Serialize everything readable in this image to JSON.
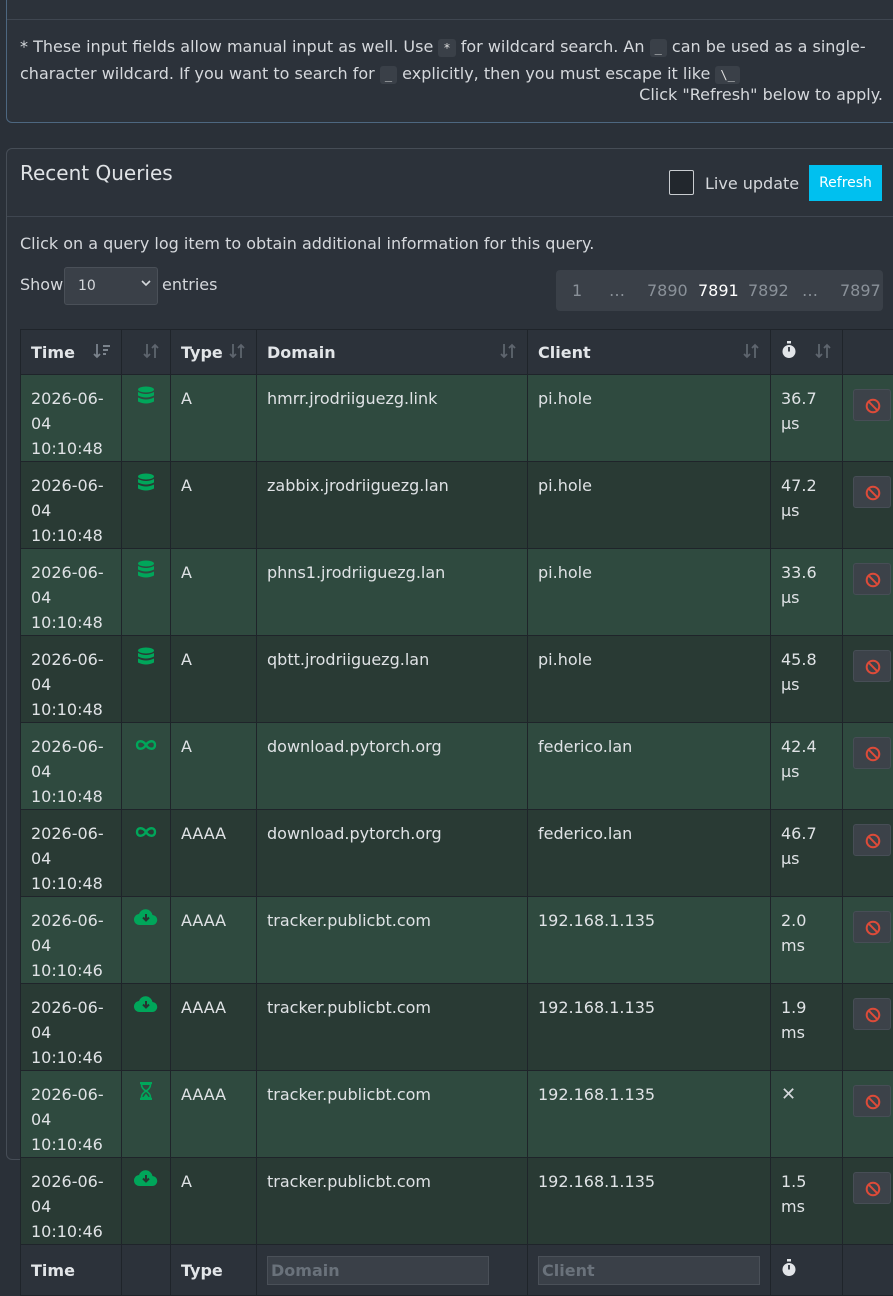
{
  "filter_box": {
    "note_segments": [
      {
        "text": "* These input fields allow manual input as well. Use "
      },
      {
        "code": "*"
      },
      {
        "text": " for wildcard search. An "
      },
      {
        "code": "_"
      },
      {
        "text": " can be used as a single-character wildcard. If you want to search for "
      },
      {
        "code": "_"
      },
      {
        "text": " explicitly, then you must escape it like "
      },
      {
        "code": "\\_"
      }
    ],
    "apply_text": "Click \"Refresh\" below to apply."
  },
  "recent": {
    "title": "Recent Queries",
    "live_update_label": "Live update",
    "live_update_checked": false,
    "refresh_label": "Refresh",
    "info_text": "Click on a query log item to obtain additional information for this query.",
    "show_label": "Show",
    "entries_value": "10",
    "entries_label": "entries",
    "pagination": [
      "1",
      "…",
      "7890",
      "7891",
      "7892",
      "…",
      "7897"
    ],
    "current_page": "7891"
  },
  "table": {
    "headers": {
      "time": "Time",
      "type": "Type",
      "domain": "Domain",
      "client": "Client"
    },
    "rows": [
      {
        "date": "2026-06-04",
        "clock": "10:10:48",
        "status_icon": "database-icon",
        "type": "A",
        "domain": "hmrr.jrodriiguezg.link",
        "client": "pi.hole",
        "reply_time": "36.7 µs"
      },
      {
        "date": "2026-06-04",
        "clock": "10:10:48",
        "status_icon": "database-icon",
        "type": "A",
        "domain": "zabbix.jrodriiguezg.lan",
        "client": "pi.hole",
        "reply_time": "47.2 µs"
      },
      {
        "date": "2026-06-04",
        "clock": "10:10:48",
        "status_icon": "database-icon",
        "type": "A",
        "domain": "phns1.jrodriiguezg.lan",
        "client": "pi.hole",
        "reply_time": "33.6 µs"
      },
      {
        "date": "2026-06-04",
        "clock": "10:10:48",
        "status_icon": "database-icon",
        "type": "A",
        "domain": "qbtt.jrodriiguezg.lan",
        "client": "pi.hole",
        "reply_time": "45.8 µs"
      },
      {
        "date": "2026-06-04",
        "clock": "10:10:48",
        "status_icon": "infinity-icon",
        "type": "A",
        "domain": "download.pytorch.org",
        "client": "federico.lan",
        "reply_time": "42.4 µs"
      },
      {
        "date": "2026-06-04",
        "clock": "10:10:48",
        "status_icon": "infinity-icon",
        "type": "AAAA",
        "domain": "download.pytorch.org",
        "client": "federico.lan",
        "reply_time": "46.7 µs"
      },
      {
        "date": "2026-06-04",
        "clock": "10:10:46",
        "status_icon": "cloud-download-icon",
        "type": "AAAA",
        "domain": "tracker.publicbt.com",
        "client": "192.168.1.135",
        "reply_time": "2.0 ms"
      },
      {
        "date": "2026-06-04",
        "clock": "10:10:46",
        "status_icon": "cloud-download-icon",
        "type": "AAAA",
        "domain": "tracker.publicbt.com",
        "client": "192.168.1.135",
        "reply_time": "1.9 ms"
      },
      {
        "date": "2026-06-04",
        "clock": "10:10:46",
        "status_icon": "hourglass-icon",
        "type": "AAAA",
        "domain": "tracker.publicbt.com",
        "client": "192.168.1.135",
        "reply_time": "✕"
      },
      {
        "date": "2026-06-04",
        "clock": "10:10:46",
        "status_icon": "cloud-download-icon",
        "type": "A",
        "domain": "tracker.publicbt.com",
        "client": "192.168.1.135",
        "reply_time": "1.5 ms"
      }
    ],
    "footer": {
      "time": "Time",
      "type": "Type",
      "domain_placeholder": "Domain",
      "client_placeholder": "Client"
    }
  },
  "colors": {
    "status_green": "#00a65a",
    "refresh_button": "#00c0ef",
    "block_icon_red": "#dd4b39",
    "row_odd": "#2f4a3f",
    "row_even": "#293a34"
  }
}
